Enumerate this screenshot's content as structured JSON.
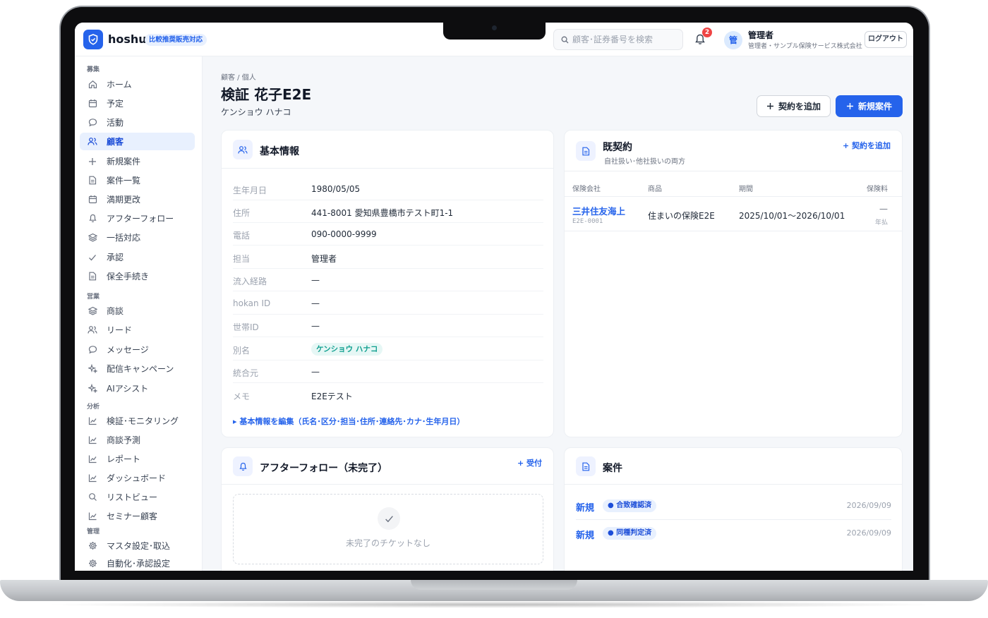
{
  "app": {
    "brand": "hoshu",
    "brand_badge": "比較推奨販売対応"
  },
  "header": {
    "search_placeholder": "顧客･証券番号を検索",
    "notifications_count": "2",
    "avatar_char": "管",
    "user_name": "管理者",
    "user_org": "管理者・サンプル保険サービス株式会社",
    "logout_label": "ログアウト"
  },
  "sidebar": {
    "sections": [
      {
        "title": "募集",
        "items": [
          {
            "label": "ホーム",
            "icon": "home-icon"
          },
          {
            "label": "予定",
            "icon": "calendar-icon"
          },
          {
            "label": "活動",
            "icon": "chat-icon"
          },
          {
            "label": "顧客",
            "icon": "users-icon",
            "active": true
          },
          {
            "label": "新規案件",
            "icon": "plus-icon"
          },
          {
            "label": "案件一覧",
            "icon": "document-icon"
          },
          {
            "label": "満期更改",
            "icon": "calendar-icon"
          },
          {
            "label": "アフターフォロー",
            "icon": "bell-icon"
          },
          {
            "label": "一括対応",
            "icon": "layers-icon"
          },
          {
            "label": "承認",
            "icon": "check-icon"
          },
          {
            "label": "保全手続き",
            "icon": "document-icon"
          }
        ]
      },
      {
        "title": "営業",
        "items": [
          {
            "label": "商談",
            "icon": "layers-icon"
          },
          {
            "label": "リード",
            "icon": "users-icon"
          },
          {
            "label": "メッセージ",
            "icon": "chat-icon"
          },
          {
            "label": "配信キャンペーン",
            "icon": "sparkle-icon"
          },
          {
            "label": "AIアシスト",
            "icon": "sparkle-icon"
          }
        ]
      },
      {
        "title": "分析",
        "items": [
          {
            "label": "検証･モニタリング",
            "icon": "chart-icon"
          },
          {
            "label": "商談予測",
            "icon": "chart-icon"
          },
          {
            "label": "レポート",
            "icon": "chart-icon"
          },
          {
            "label": "ダッシュボード",
            "icon": "chart-icon"
          },
          {
            "label": "リストビュー",
            "icon": "search-icon"
          },
          {
            "label": "セミナー顧客",
            "icon": "chart-icon"
          }
        ]
      },
      {
        "title": "管理",
        "items": [
          {
            "label": "マスタ設定･取込",
            "icon": "gear-icon"
          },
          {
            "label": "自動化･承認設定",
            "icon": "gear-icon"
          }
        ]
      }
    ]
  },
  "page": {
    "breadcrumb": "顧客 / 個人",
    "title": "検証 花子E2E",
    "kana": "ケンショウ ハナコ",
    "add_contract_label": "契約を追加",
    "new_case_label": "新規案件"
  },
  "basic_info": {
    "title": "基本情報",
    "rows": [
      {
        "label": "生年月日",
        "value": "1980/05/05"
      },
      {
        "label": "住所",
        "value": "441-8001 愛知県豊橋市テスト町1-1"
      },
      {
        "label": "電話",
        "value": "090-0000-9999"
      },
      {
        "label": "担当",
        "value": "管理者"
      },
      {
        "label": "流入経路",
        "value": "—"
      },
      {
        "label": "hokan ID",
        "value": "—"
      },
      {
        "label": "世帯ID",
        "value": "—"
      },
      {
        "label": "別名",
        "value": "ケンショウ ハナコ",
        "pill": true
      },
      {
        "label": "統合元",
        "value": "—"
      },
      {
        "label": "メモ",
        "value": "E2Eテスト"
      }
    ],
    "edit_link": "▸ 基本情報を編集（氏名･区分･担当･住所･連絡先･カナ･生年月日）"
  },
  "contracts": {
    "title": "既契約",
    "subtitle": "自社扱い･他社扱いの両方",
    "add_link": "+ 契約を追加",
    "columns": [
      "保険会社",
      "商品",
      "期間",
      "保険料"
    ],
    "rows": [
      {
        "company": "三井住友海上",
        "code": "E2E-0001",
        "product": "住まいの保険E2E",
        "period": "2025/10/01〜2026/10/01",
        "premium": "—",
        "payment": "年払"
      }
    ]
  },
  "after_follow": {
    "title": "アフターフォロー（未完了）",
    "add_link": "+ 受付",
    "empty_text": "未完了のチケットなし"
  },
  "cases": {
    "title": "案件",
    "rows": [
      {
        "type": "新規",
        "status": "● 合致確認済",
        "date": "2026/09/09"
      },
      {
        "type": "新規",
        "status": "● 同種判定済",
        "date": "2026/09/09"
      }
    ]
  },
  "colors": {
    "accent": "#2563eb",
    "sidebar_active_bg": "#e8f0fe",
    "alias_pill": "#0f9f8f",
    "notification": "#ef4444"
  }
}
